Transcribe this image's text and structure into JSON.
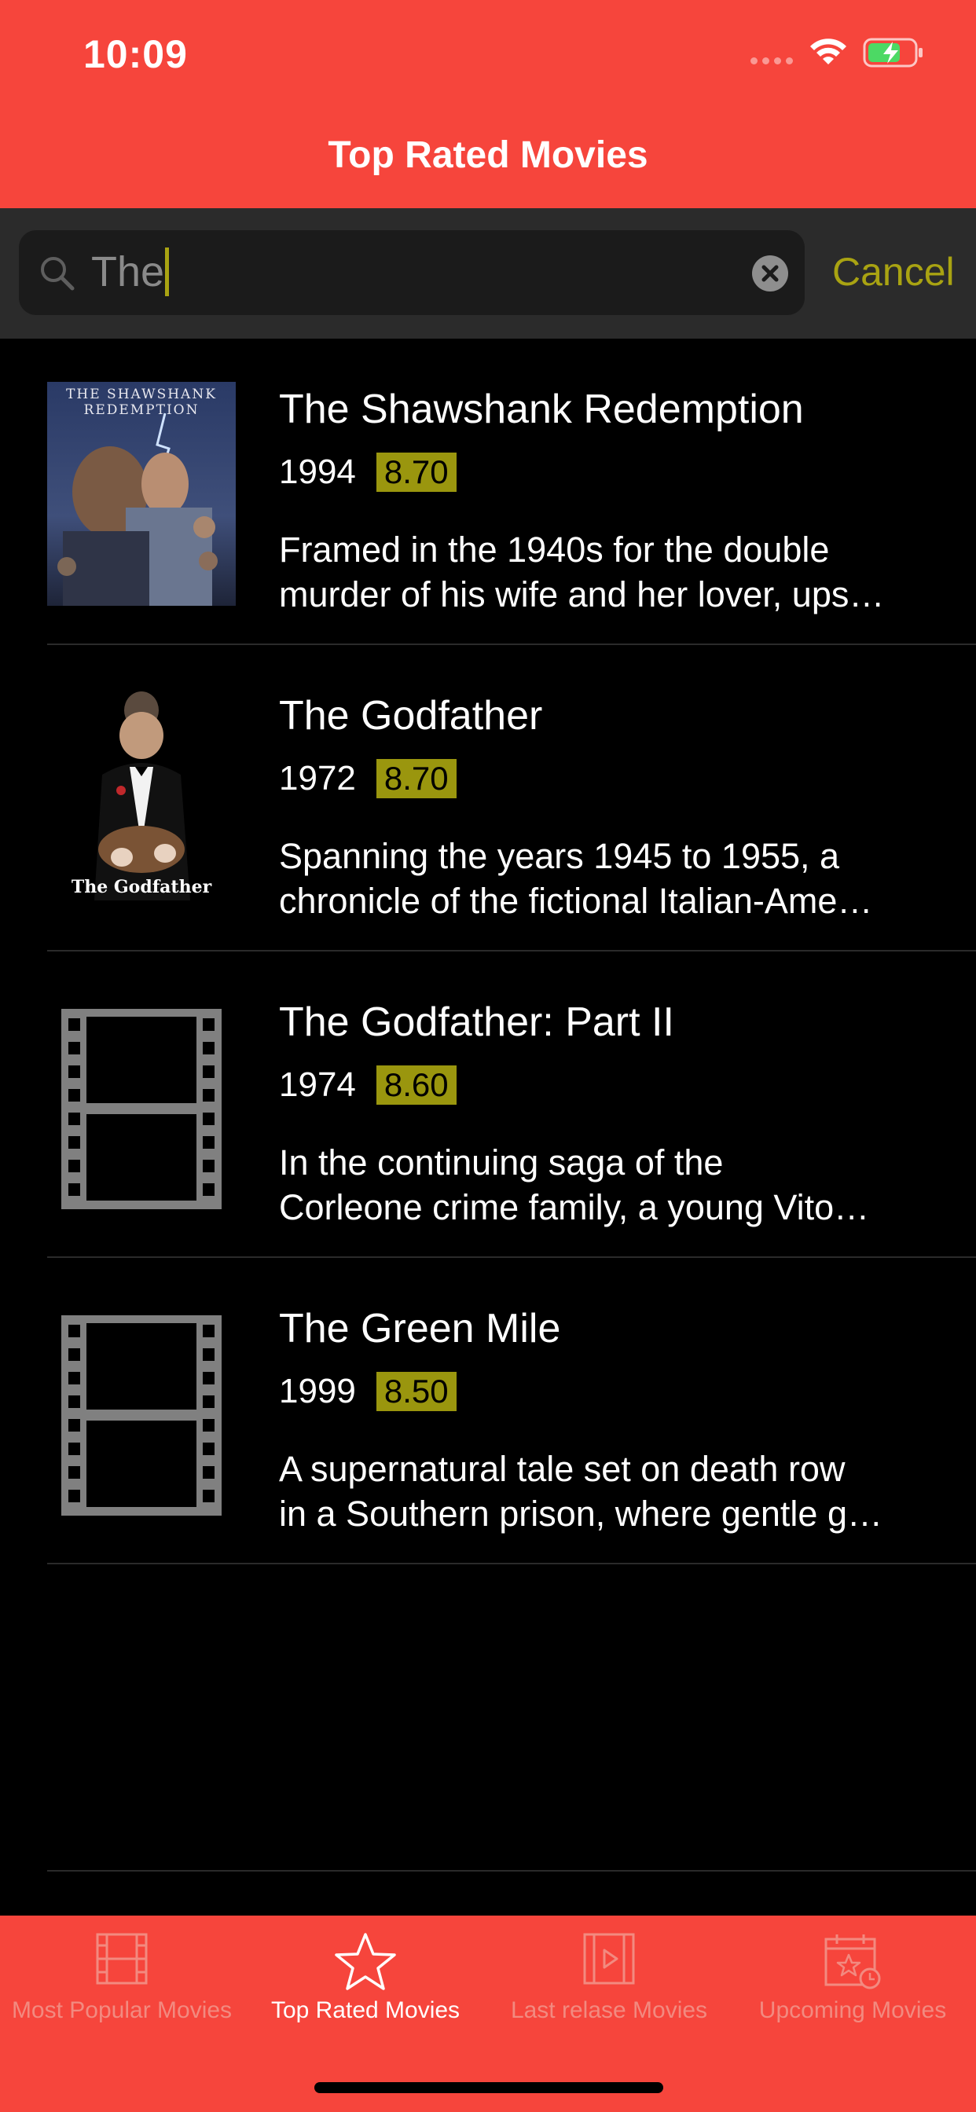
{
  "status_bar": {
    "time": "10:09",
    "icons": [
      "signal-dots-icon",
      "wifi-icon",
      "battery-charging-icon"
    ]
  },
  "nav": {
    "title": "Top Rated Movies"
  },
  "search": {
    "query": "The",
    "cancel_label": "Cancel",
    "icons": [
      "search-icon",
      "clear-icon"
    ]
  },
  "colors": {
    "accent": "#f6453c",
    "highlight": "#9a960e",
    "background": "#000000"
  },
  "movies": [
    {
      "title": "The Shawshank Redemption",
      "year": "1994",
      "rating": "8.70",
      "overview_line1": "Framed in the 1940s for the double",
      "overview_line2": "murder of his wife and her lover, ups…",
      "poster_title": "THE SHAWSHANK REDEMPTION"
    },
    {
      "title": "The Godfather",
      "year": "1972",
      "rating": "8.70",
      "overview_line1": "Spanning the years 1945 to 1955, a",
      "overview_line2": "chronicle of the fictional Italian-Ame…",
      "poster_title": "The Godfather"
    },
    {
      "title": "The Godfather: Part II",
      "year": "1974",
      "rating": "8.60",
      "overview_line1": "In the continuing saga of the",
      "overview_line2": "Corleone crime family, a young Vito…",
      "poster_title": ""
    },
    {
      "title": "The Green Mile",
      "year": "1999",
      "rating": "8.50",
      "overview_line1": "A supernatural tale set on death row",
      "overview_line2": "in a Southern prison, where gentle g…",
      "poster_title": ""
    }
  ],
  "tabs": [
    {
      "label": "Most Popular Movies",
      "icon": "film-icon",
      "active": false
    },
    {
      "label": "Top Rated Movies",
      "icon": "star-icon",
      "active": true
    },
    {
      "label": "Last relase Movies",
      "icon": "play-film-icon",
      "active": false
    },
    {
      "label": "Upcoming Movies",
      "icon": "calendar-star-icon",
      "active": false
    }
  ]
}
